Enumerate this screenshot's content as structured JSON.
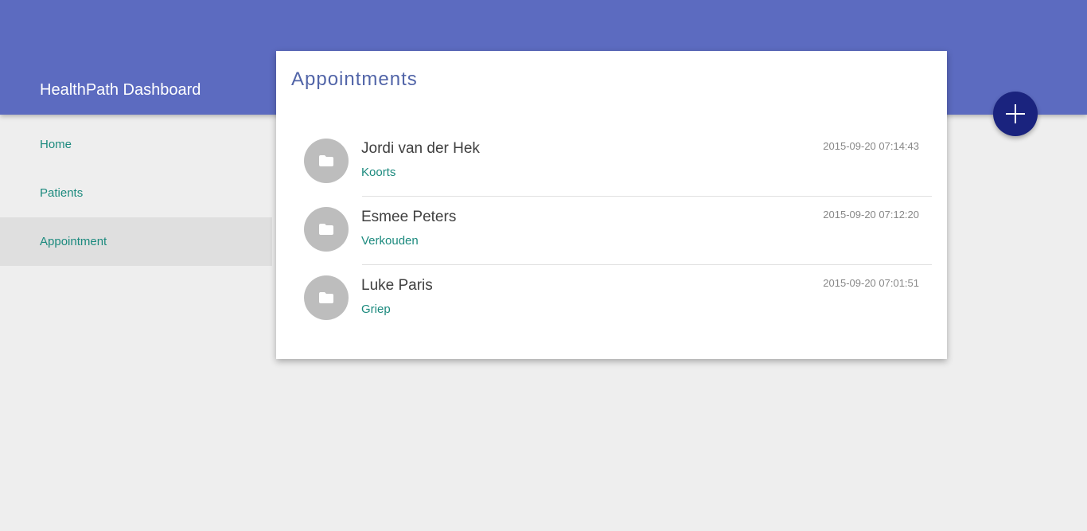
{
  "app": {
    "title": "HealthPath Dashboard"
  },
  "sidebar": {
    "items": [
      {
        "label": "Home",
        "active": false
      },
      {
        "label": "Patients",
        "active": false
      },
      {
        "label": "Appointment",
        "active": true
      }
    ]
  },
  "main": {
    "title": "Appointments",
    "appointments": [
      {
        "name": "Jordi van der Hek",
        "complaint": "Koorts",
        "timestamp": "2015-09-20 07:14:43",
        "icon": "folder-icon"
      },
      {
        "name": "Esmee Peters",
        "complaint": "Verkouden",
        "timestamp": "2015-09-20 07:12:20",
        "icon": "folder-icon"
      },
      {
        "name": "Luke Paris",
        "complaint": "Griep",
        "timestamp": "2015-09-20 07:01:51",
        "icon": "folder-icon"
      }
    ]
  },
  "fab": {
    "icon": "plus-icon"
  },
  "colors": {
    "header": "#5c6bc0",
    "accent_text": "#1c8a7e",
    "fab": "#1a237e",
    "avatar": "#bdbdbd",
    "card_title": "#5265a8",
    "background": "#eeeeee"
  }
}
